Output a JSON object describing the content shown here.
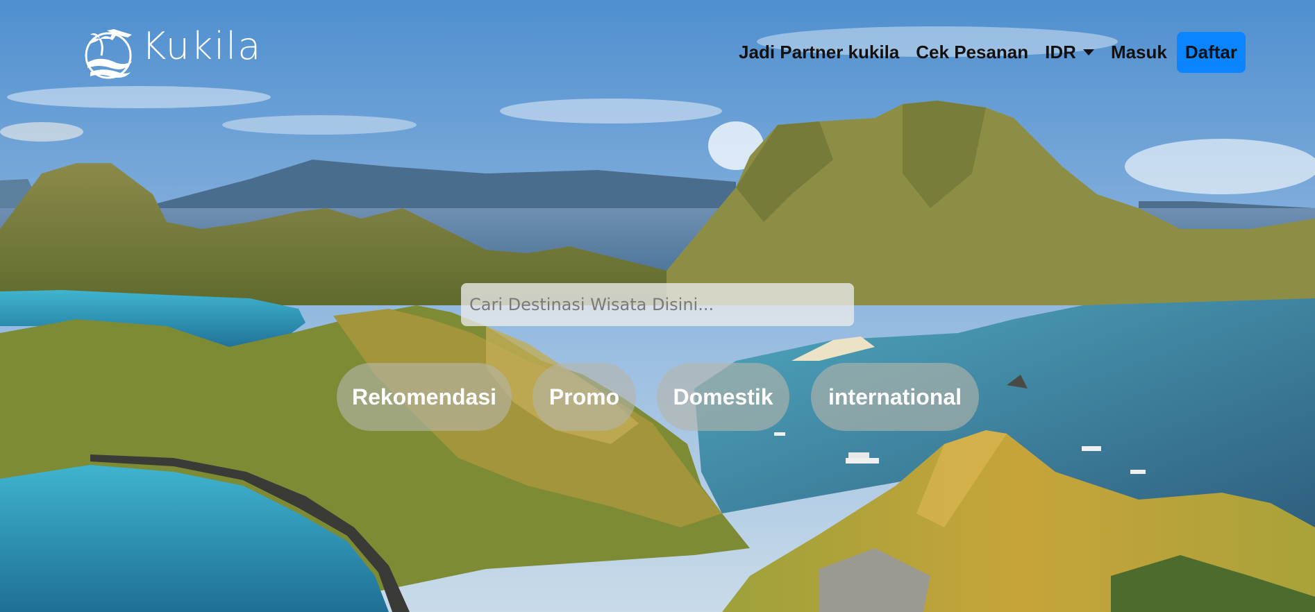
{
  "brand": {
    "name": "Kukila"
  },
  "nav": {
    "partner_label": "Jadi Partner kukila",
    "orders_label": "Cek Pesanan",
    "currency_label": "IDR",
    "login_label": "Masuk",
    "register_label": "Daftar"
  },
  "search": {
    "placeholder": "Cari Destinasi Wisata Disini..."
  },
  "categories": [
    "Rekomendasi",
    "Promo",
    "Domestik",
    "international"
  ],
  "icons": {
    "logo": "airplane-palm-wave-logo-icon",
    "currency_dropdown": "chevron-down-icon"
  },
  "colors": {
    "accent": "#0b84ff",
    "nav_text": "#111111"
  }
}
